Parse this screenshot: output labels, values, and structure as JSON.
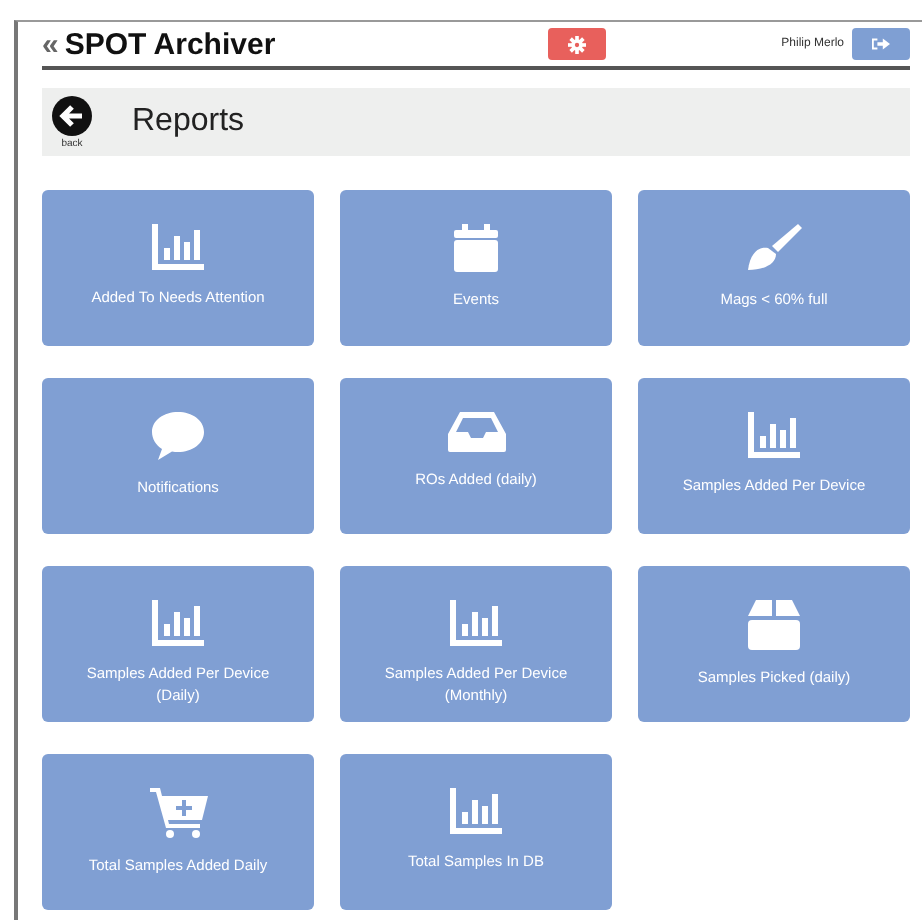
{
  "header": {
    "collapse_icon": "«",
    "title": "SPOT Archiver",
    "user": "Philip Merlo"
  },
  "page": {
    "back_label": "back",
    "title": "Reports"
  },
  "tiles": [
    {
      "label": "Added To Needs Attention",
      "kind": "chart"
    },
    {
      "label": "Events",
      "kind": "calendar"
    },
    {
      "label": "Mags < 60% full",
      "kind": "brush"
    },
    {
      "label": "Notifications",
      "kind": "chat"
    },
    {
      "label": "ROs Added (daily)",
      "kind": "inbox"
    },
    {
      "label": "Samples Added Per Device",
      "kind": "chart"
    },
    {
      "label": "Samples Added Per Device (Daily)",
      "kind": "chart"
    },
    {
      "label": "Samples Added Per Device (Monthly)",
      "kind": "chart"
    },
    {
      "label": "Samples Picked (daily)",
      "kind": "box"
    },
    {
      "label": "Total Samples Added Daily",
      "kind": "cart"
    },
    {
      "label": "Total Samples In DB",
      "kind": "chart"
    }
  ]
}
